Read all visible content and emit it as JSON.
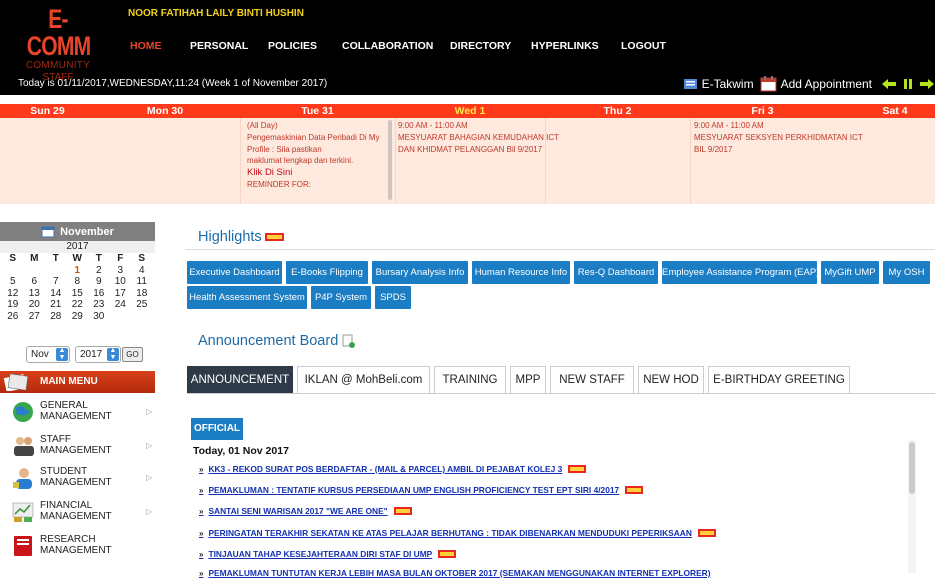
{
  "header": {
    "logo": {
      "line1": "E-COMM",
      "line2": "COMMUNITY",
      "line3": "STAFF"
    },
    "user_name": "NOOR FATIHAH LAILY BINTI HUSHIN",
    "nav": [
      "HOME",
      "PERSONAL",
      "POLICIES",
      "COLLABORATION",
      "DIRECTORY",
      "HYPERLINKS",
      "LOGOUT"
    ],
    "nav_active": "HOME",
    "today_text": "Today is 01/11/2017,WEDNESDAY,11:24 (Week 1 of November 2017)",
    "tools": {
      "etakwim": "E-Takwim",
      "add_appointment": "Add Appointment"
    }
  },
  "calendar": {
    "days": [
      "Sun 29",
      "Mon 30",
      "Tue 31",
      "Wed 1",
      "Thu 2",
      "Fri 3",
      "Sat 4"
    ],
    "today_index": 3,
    "events": {
      "tue": [
        "(All Day)",
        "Pengemaskinian Data Peribadi Di My",
        "Profile : Sila pastikan",
        "maklumat lengkap dan terkini.",
        "Klik Di Sini",
        "REMINDER FOR:"
      ],
      "wed": [
        "9:00 AM - 11:00 AM",
        "MESYUARAT BAHAGIAN KEMUDAHAN ICT",
        "DAN KHIDMAT PELANGGAN Bil 9/2017"
      ],
      "fri": [
        "9:00 AM - 11:00 AM",
        "MESYUARAT SEKSYEN PERKHIDMATAN ICT",
        "BIL 9/2017"
      ]
    }
  },
  "mini_calendar": {
    "month": "November",
    "year": "2017",
    "weekdays": [
      "S",
      "M",
      "T",
      "W",
      "T",
      "F",
      "S"
    ],
    "weeks": [
      [
        "",
        "",
        "",
        "1",
        "2",
        "3",
        "4"
      ],
      [
        "5",
        "6",
        "7",
        "8",
        "9",
        "10",
        "11"
      ],
      [
        "12",
        "13",
        "14",
        "15",
        "16",
        "17",
        "18"
      ],
      [
        "19",
        "20",
        "21",
        "22",
        "23",
        "24",
        "25"
      ],
      [
        "26",
        "27",
        "28",
        "29",
        "30",
        "",
        ""
      ]
    ],
    "today": "1",
    "select_month": "Nov",
    "select_year": "2017",
    "go_label": "GO"
  },
  "main_menu": {
    "title": "MAIN MENU",
    "items": [
      {
        "label": "GENERAL\nMANAGEMENT",
        "icon": "globe-icon"
      },
      {
        "label": "STAFF\nMANAGEMENT",
        "icon": "staff-icon"
      },
      {
        "label": "STUDENT\nMANAGEMENT",
        "icon": "student-icon"
      },
      {
        "label": "FINANCIAL\nMANAGEMENT",
        "icon": "financial-icon"
      },
      {
        "label": "RESEARCH\nMANAGEMENT",
        "icon": "research-icon"
      }
    ]
  },
  "highlights": {
    "title": "Highlights",
    "buttons": [
      "Executive Dashboard",
      "E-Books Flipping",
      "Bursary Analysis Info",
      "Human Resource Info",
      "Res-Q Dashboard",
      "Employee Assistance Program (EAP)",
      "MyGift UMP",
      "My OSH",
      "Health Assessment System",
      "P4P System",
      "SPDS"
    ]
  },
  "announcement": {
    "title": "Announcement Board",
    "tabs": [
      "ANNOUNCEMENT",
      "IKLAN @ MohBeli.com",
      "TRAINING",
      "MPP",
      "NEW STAFF",
      "NEW HOD",
      "E-BIRTHDAY GREETING"
    ],
    "active_tab": "ANNOUNCEMENT",
    "filter": "OFFICIAL",
    "today_heading": "Today, 01 Nov 2017",
    "items": [
      "KK3 - REKOD SURAT POS BERDAFTAR - (MAIL & PARCEL) AMBIL DI PEJABAT KOLEJ 3",
      "PEMAKLUMAN : TENTATIF KURSUS PERSEDIAAN UMP ENGLISH PROFICIENCY TEST EPT SIRI 4/2017",
      "SANTAI SENI WARISAN 2017 \"WE ARE ONE\"",
      "PERINGATAN TERAKHIR SEKATAN KE ATAS PELAJAR BERHUTANG : TIDAK DIBENARKAN MENDUDUKI PEPERIKSAAN",
      "TINJAUAN TAHAP KESEJAHTERAAN DIRI STAF DI UMP",
      "PEMAKLUMAN TUNTUTAN KERJA LEBIH MASA BULAN OKTOBER 2017 (SEMAKAN MENGGUNAKAN INTERNET EXPLORER)"
    ],
    "new_badge": "NEW"
  },
  "colors": {
    "header_bg": "#000000",
    "accent_red": "#ff3a1a",
    "button_blue": "#1b7dc4",
    "tab_active": "#2f3a48"
  }
}
